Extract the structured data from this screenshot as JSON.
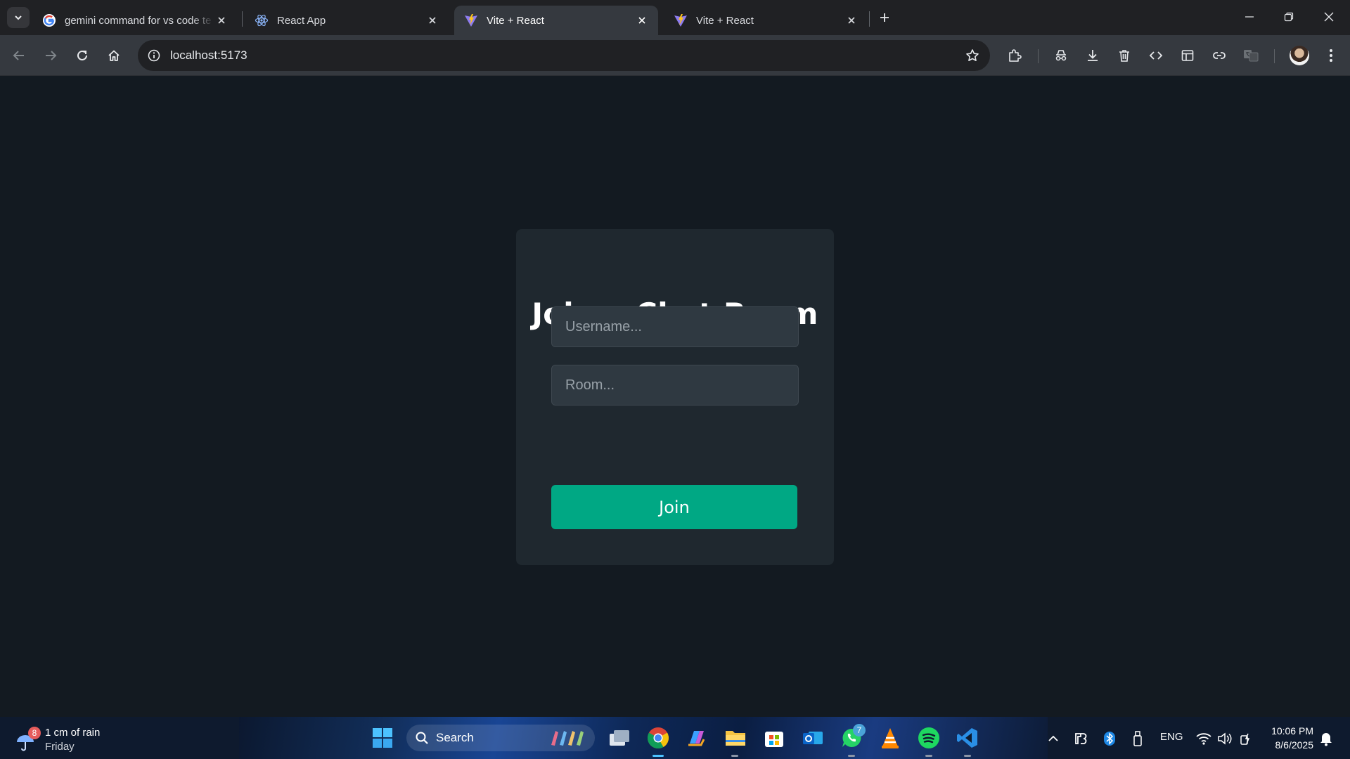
{
  "browser": {
    "tabs": [
      {
        "title": "gemini command for vs code te",
        "favicon": "google-icon",
        "active": false
      },
      {
        "title": "React App",
        "favicon": "react-icon",
        "active": false
      },
      {
        "title": "Vite + React",
        "favicon": "vite-icon",
        "active": true
      },
      {
        "title": "Vite + React",
        "favicon": "vite-icon",
        "active": false
      }
    ],
    "url": "localhost:5173"
  },
  "page": {
    "heading": "Join a Chat Room",
    "username_placeholder": "Username...",
    "room_placeholder": "Room...",
    "join_label": "Join",
    "colors": {
      "background": "#131a21",
      "card": "#1f282f",
      "input": "#2f3941",
      "accent": "#00a884"
    }
  },
  "taskbar": {
    "weather": {
      "badge": "8",
      "line1": "1 cm of rain",
      "line2": "Friday"
    },
    "search_label": "Search",
    "whatsapp_badge": "7",
    "language": "ENG",
    "time": "10:06 PM",
    "date": "8/6/2025"
  }
}
